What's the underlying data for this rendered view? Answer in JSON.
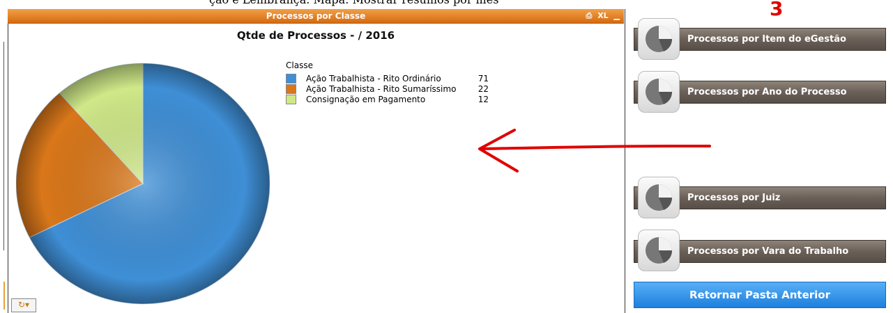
{
  "top_fragment": "çao e Lembrança. Mapa: Mostrar resumos por mês",
  "panel": {
    "title": "Processos por Classe",
    "icons": [
      "print-icon",
      "XL",
      "minimize-icon"
    ],
    "xl_label": "XL"
  },
  "chart_data": {
    "type": "pie",
    "title": "Qtde de Processos - / 2016",
    "legend_title": "Classe",
    "legend_placement": "right",
    "series": [
      {
        "name": "Ação Trabalhista - Rito Ordinário",
        "value": 71,
        "color": "#3f8fd6"
      },
      {
        "name": "Ação Trabalhista - Rito Sumaríssimo",
        "value": 22,
        "color": "#d9771a"
      },
      {
        "name": "Consignação em Pagamento",
        "value": 12,
        "color": "#cfe888"
      }
    ]
  },
  "annotation": {
    "badge": "3",
    "arrow_color": "#e00000"
  },
  "side_buttons": [
    {
      "label": "Processos por Item do eGestão",
      "icon": "pie-chart-icon"
    },
    {
      "label": "Processos por Ano do Processo",
      "icon": "pie-chart-icon"
    },
    {
      "label": "Processos por Juiz",
      "icon": "pie-chart-icon"
    },
    {
      "label": "Processos por Vara do Trabalho",
      "icon": "pie-chart-icon"
    }
  ],
  "return_button": {
    "label": "Retornar Pasta Anterior"
  },
  "colors": {
    "header_orange": "#e07a20",
    "button_blue": "#2f8fe8",
    "button_gray": "#6a6058"
  }
}
